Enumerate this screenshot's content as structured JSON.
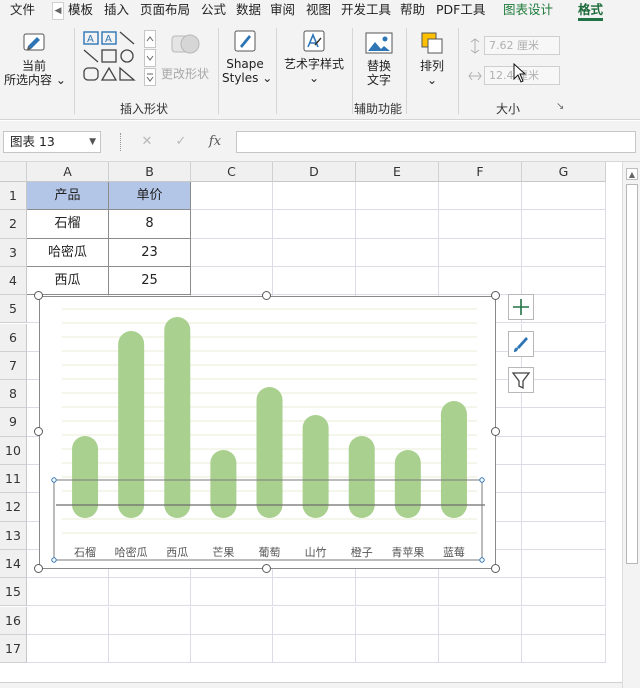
{
  "ribbon_tabs": [
    "文件",
    "模板",
    "插入",
    "页面布局",
    "公式",
    "数据",
    "审阅",
    "视图",
    "开发工具",
    "帮助",
    "PDF工具",
    "图表设计",
    "格式"
  ],
  "active_tab": "格式",
  "ribbon": {
    "current_selection_label_1": "当前",
    "current_selection_label_2": "所选内容",
    "insert_shapes_label": "插入形状",
    "change_shape_label": "更改形状",
    "shape_styles_label_1": "Shape",
    "shape_styles_label_2": "Styles",
    "wordart_styles_label": "艺术字样式",
    "alt_text_label_1": "替换",
    "alt_text_label_2": "文字",
    "accessibility_group_label": "辅助功能",
    "arrange_label": "排列",
    "size_group_label": "大小",
    "height_value": "7.62 厘米",
    "width_value": "12.4 厘米",
    "dropdown_glyph": "⌄",
    "launcher_glyph": "↘"
  },
  "formula_bar": {
    "name_box": "图表 13",
    "name_box_arrow": "▼",
    "fx": "fx",
    "cancel_glyph": "✕",
    "enter_glyph": "✓",
    "formula": ""
  },
  "columns": [
    "A",
    "B",
    "C",
    "D",
    "E",
    "F",
    "G"
  ],
  "rows": [
    "1",
    "2",
    "3",
    "4",
    "5",
    "6",
    "7",
    "8",
    "9",
    "10",
    "11",
    "12",
    "13",
    "14",
    "15",
    "16",
    "17"
  ],
  "table": {
    "header": [
      "产品",
      "单价"
    ],
    "rows": [
      [
        "石榴",
        "8"
      ],
      [
        "哈密瓜",
        "23"
      ],
      [
        "西瓜",
        "25"
      ]
    ]
  },
  "chart_data": {
    "type": "bar",
    "categories": [
      "石榴",
      "哈密瓜",
      "西瓜",
      "芒果",
      "葡萄",
      "山竹",
      "橙子",
      "青苹果",
      "蓝莓"
    ],
    "values": [
      8,
      23,
      25,
      6,
      15,
      11,
      8,
      6,
      13
    ],
    "ylim": [
      -4,
      28
    ],
    "grid": true,
    "legend": "none",
    "bar_color": "#a9d08e",
    "gridline_color": "#e8ecd9",
    "axis_color": "#6e6e6e",
    "xlabel": "",
    "ylabel": ""
  },
  "colors": {
    "accent_green": "#217346",
    "header_fill": "#b4c6e7"
  }
}
